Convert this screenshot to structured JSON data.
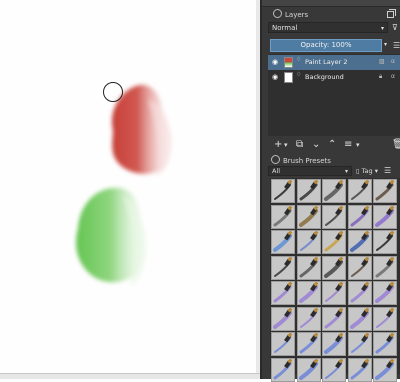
{
  "dock": {
    "layers": {
      "title": "Layers",
      "blend_mode": "Normal",
      "opacity_label": "Opacity:  100%",
      "items": [
        {
          "name": "Paint Layer 2",
          "active": true
        },
        {
          "name": "Background",
          "active": false
        }
      ]
    },
    "brush_presets": {
      "title": "Brush Presets",
      "tag_filter": "All",
      "tag_button": "Tag"
    }
  },
  "colors": {
    "stroke_red": "#c9483f",
    "stroke_green": "#6fc95b",
    "accent_selection": "#4d6f8f",
    "opacity_bar": "#4f7ca3",
    "dock_bg": "#383838"
  },
  "icons": [
    "eye-icon",
    "lock-icon",
    "alpha-inherit-icon",
    "filter-icon",
    "add-layer-icon",
    "duplicate-layer-icon",
    "move-down-icon",
    "move-up-icon",
    "layer-properties-icon",
    "delete-layer-icon",
    "brush-cursor-icon"
  ]
}
